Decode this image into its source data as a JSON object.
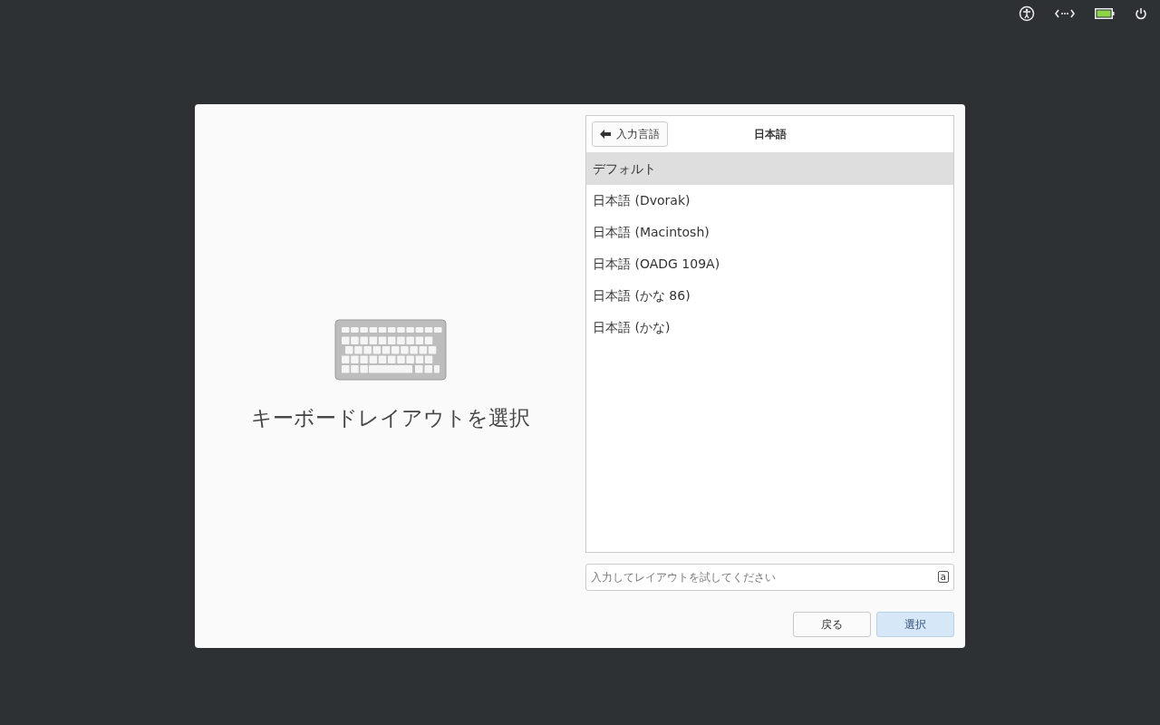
{
  "dialog": {
    "heading": "キーボードレイアウトを選択",
    "list_header": {
      "back_button": "入力言語",
      "title": "日本語"
    },
    "layouts": [
      {
        "label": "デフォルト",
        "selected": true
      },
      {
        "label": "日本語 (Dvorak)",
        "selected": false
      },
      {
        "label": "日本語 (Macintosh)",
        "selected": false
      },
      {
        "label": "日本語 (OADG 109A)",
        "selected": false
      },
      {
        "label": "日本語 (かな 86)",
        "selected": false
      },
      {
        "label": "日本語 (かな)",
        "selected": false
      }
    ],
    "test_field": {
      "placeholder": "入力してレイアウトを試してください",
      "layout_indicator": "a"
    },
    "buttons": [
      {
        "label": "戻る",
        "kind": "secondary"
      },
      {
        "label": "選択",
        "kind": "primary"
      }
    ]
  }
}
